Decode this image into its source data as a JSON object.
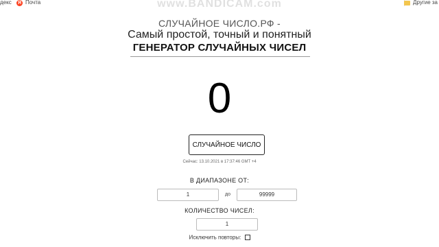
{
  "bookmarks": {
    "left_partial": "декс",
    "mail": "Почта",
    "other": "Другие за"
  },
  "watermark": "www.BANDICAM.com",
  "site": {
    "line1": "СЛУЧАЙНОЕ ЧИСЛО.РФ -",
    "line2": "Самый простой, точный и понятный",
    "line3": "ГЕНЕРАТОР СЛУЧАЙНЫХ ЧИСЕЛ"
  },
  "result": "0",
  "generate_button": "СЛУЧАЙНОЕ ЧИСЛО",
  "now_text": "Сейчас: 13.10.2021 в 17:37:46 GMT +4",
  "range": {
    "label": "В ДИАПАЗОНЕ ОТ:",
    "from": "1",
    "to_label": "до",
    "to": "99999"
  },
  "count": {
    "label": "КОЛИЧЕСТВО ЧИСЕЛ:",
    "value": "1"
  },
  "exclude_repeats": {
    "label": "Исключить повторы:",
    "checked": false
  },
  "colors": {
    "yandex_red": "#fc3f1d",
    "folder_yellow": "#f3c64f"
  }
}
